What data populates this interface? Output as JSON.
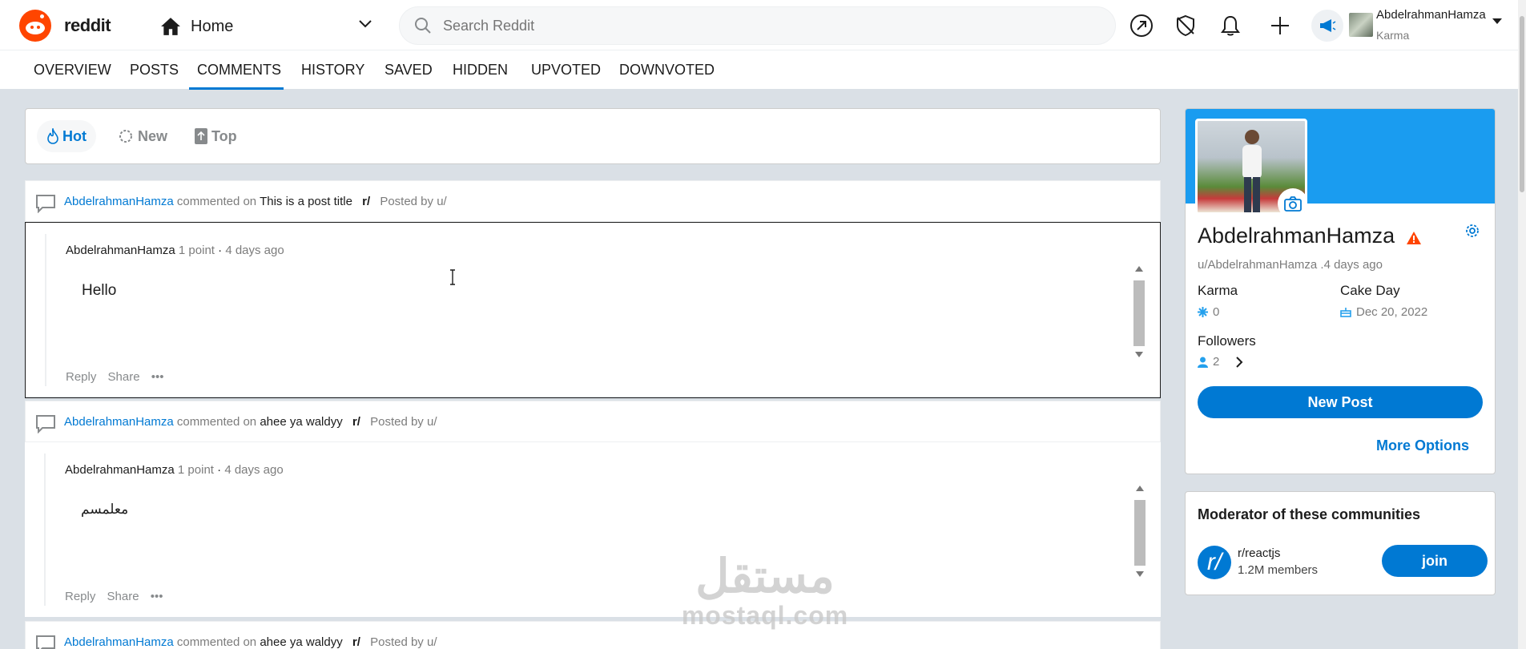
{
  "header": {
    "brand": "reddit",
    "home_label": "Home",
    "search_placeholder": "Search Reddit",
    "user_name": "AbdelrahmanHamza",
    "user_karma_label": "Karma"
  },
  "tabs": [
    "OVERVIEW",
    "POSTS",
    "COMMENTS",
    "HISTORY",
    "SAVED",
    "HIDDEN",
    "UPVOTED",
    "DOWNVOTED"
  ],
  "active_tab": "COMMENTS",
  "sort": {
    "hot": "Hot",
    "new": "New",
    "top": "Top",
    "active": "Hot"
  },
  "comments": [
    {
      "author": "AbdelrahmanHamza",
      "commented_on": "commented on",
      "post_title": "This is a post title",
      "subreddit": "r/",
      "posted_by": "Posted by u/",
      "comment_author": "AbdelrahmanHamza",
      "points": "1 point",
      "age": "4 days ago",
      "text": "Hello",
      "reply": "Reply",
      "share": "Share"
    },
    {
      "author": "AbdelrahmanHamza",
      "commented_on": "commented on",
      "post_title": "ahee ya waldyy",
      "subreddit": "r/",
      "posted_by": "Posted by u/",
      "comment_author": "AbdelrahmanHamza",
      "points": "1 point",
      "age": "4 days ago",
      "text": "معلمسم",
      "reply": "Reply",
      "share": "Share"
    },
    {
      "author": "AbdelrahmanHamza",
      "commented_on": "commented on",
      "post_title": "ahee ya waldyy",
      "subreddit": "r/",
      "posted_by": "Posted by u/"
    }
  ],
  "profile": {
    "name": "AbdelrahmanHamza",
    "handle": "u/AbdelrahmanHamza .4 days ago",
    "karma_label": "Karma",
    "karma_value": "0",
    "cake_label": "Cake Day",
    "cake_value": "Dec 20, 2022",
    "followers_label": "Followers",
    "followers_value": "2",
    "new_post": "New Post",
    "more_options": "More Options"
  },
  "moderator": {
    "title": "Moderator of these communities",
    "community_icon": "r/",
    "community": "r/reactjs",
    "members": "1.2M members",
    "join": "join"
  },
  "watermark": {
    "arabic": "مستقل",
    "latin": "mostaql.com"
  },
  "colors": {
    "brand": "#ff4500",
    "accent": "#0079d3",
    "banner": "#1a9cf0",
    "background": "#dae0e6"
  }
}
